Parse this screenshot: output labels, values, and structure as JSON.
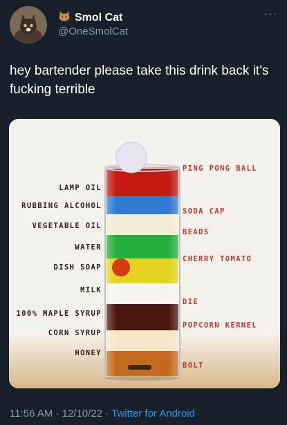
{
  "tweet": {
    "display_name": "Smol Cat",
    "handle": "@OneSmolCat",
    "text": "hey bartender please take this drink back it's fucking terrible",
    "time": "11:56 AM",
    "date": "12/10/22",
    "source": "Twitter for Android",
    "separator": "·"
  },
  "media": {
    "left_labels": [
      "LAMP OIL",
      "RUBBING ALCOHOL",
      "VEGETABLE OIL",
      "WATER",
      "DISH SOAP",
      "MILK",
      "100% MAPLE SYRUP",
      "CORN SYRUP",
      "HONEY"
    ],
    "right_labels": [
      "PING PONG BALL",
      "SODA CAP",
      "BEADS",
      "CHERRY TOMATO",
      "DIE",
      "POPCORN KERNEL",
      "BOLT"
    ]
  },
  "colors": {
    "background": "#15202b",
    "text_primary": "#ffffff",
    "text_secondary": "#8b98a5",
    "link": "#1d9bf0",
    "label_right": "#c0392b"
  },
  "icons": [
    "cat-badge-icon",
    "more-icon"
  ]
}
